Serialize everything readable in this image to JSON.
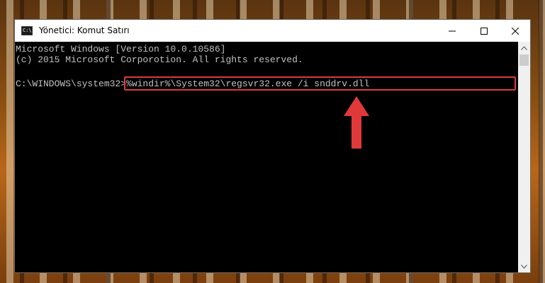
{
  "window": {
    "title": "Yönetici: Komut Satırı",
    "icon_text": "C:\\",
    "icons": {
      "app": "cmd-icon",
      "minimize": "minimize-icon",
      "maximize": "maximize-icon",
      "close": "close-icon"
    }
  },
  "console": {
    "lines": [
      "Microsoft Windows [Version 10.0.10586]",
      "(c) 2015 Microsoft Corporotion. All rights reserved."
    ],
    "prompt": "C:\\WINDOWS\\system32>",
    "command": "%windir%\\System32\\regsvr32.exe /i snddrv.dll"
  },
  "annotation": {
    "highlight_color": "#e0393a",
    "arrow_icon": "up-arrow-icon"
  },
  "colors": {
    "console_bg": "#000000",
    "console_text": "#c0c0c0",
    "titlebar_bg": "#ffffff"
  }
}
